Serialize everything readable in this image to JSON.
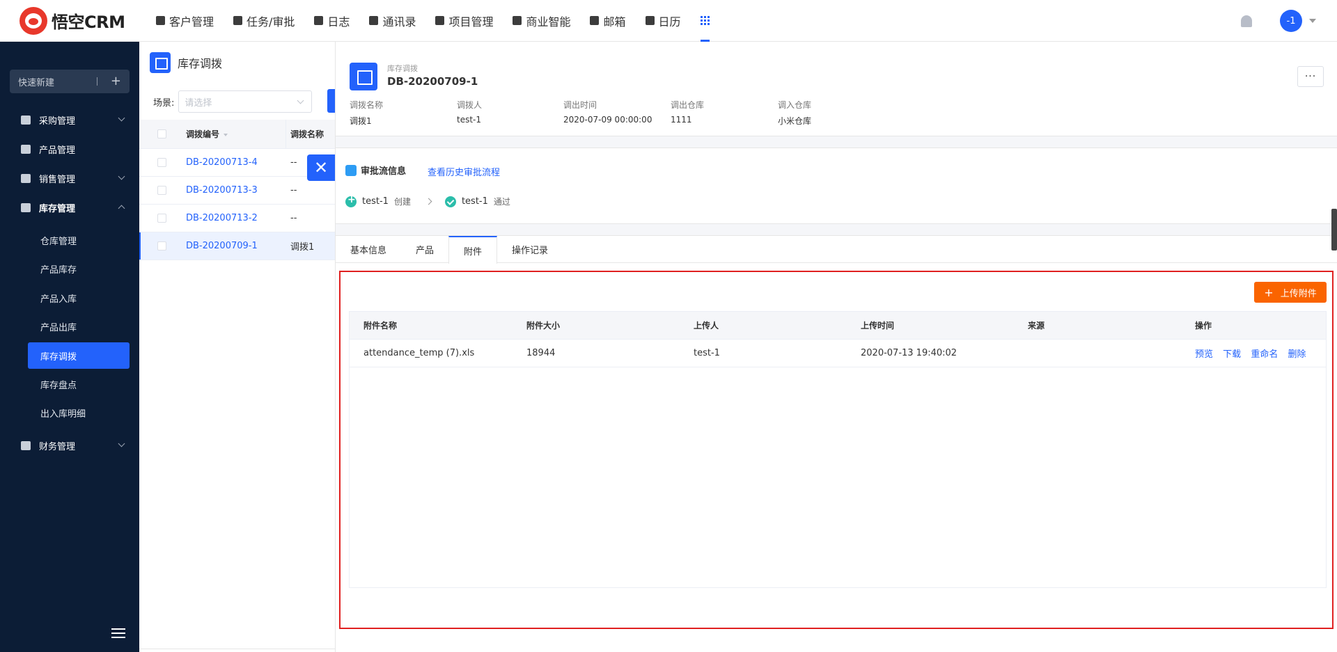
{
  "brand": {
    "name": "悟空CRM"
  },
  "nav": [
    {
      "label": "客户管理",
      "icon": "customer-icon"
    },
    {
      "label": "任务/审批",
      "icon": "task-icon"
    },
    {
      "label": "日志",
      "icon": "log-icon"
    },
    {
      "label": "通讯录",
      "icon": "contacts-icon"
    },
    {
      "label": "项目管理",
      "icon": "project-icon"
    },
    {
      "label": "商业智能",
      "icon": "bi-icon"
    },
    {
      "label": "邮箱",
      "icon": "mail-icon"
    },
    {
      "label": "日历",
      "icon": "calendar-icon"
    }
  ],
  "user": {
    "avatar_text": "-1"
  },
  "sidebar": {
    "quick_new": "快速新建",
    "menu": [
      {
        "label": "采购管理"
      },
      {
        "label": "产品管理"
      },
      {
        "label": "销售管理"
      },
      {
        "label": "库存管理"
      },
      {
        "label": "财务管理"
      }
    ],
    "sub": [
      "仓库管理",
      "产品库存",
      "产品入库",
      "产品出库",
      "库存调拨",
      "库存盘点",
      "出入库明细"
    ]
  },
  "list": {
    "title": "库存调拨",
    "scene_label": "场景:",
    "scene_placeholder": "请选择",
    "col_code": "调拨编号",
    "col_name": "调拨名称",
    "rows": [
      {
        "code": "DB-20200713-4",
        "name": "--"
      },
      {
        "code": "DB-20200713-3",
        "name": "--"
      },
      {
        "code": "DB-20200713-2",
        "name": "--"
      },
      {
        "code": "DB-20200709-1",
        "name": "调拨1"
      }
    ]
  },
  "detail": {
    "type": "库存调拨",
    "title": "DB-20200709-1",
    "more": "···",
    "fields": [
      {
        "label": "调拨名称",
        "value": "调拨1"
      },
      {
        "label": "调拨人",
        "value": "test-1"
      },
      {
        "label": "调出时间",
        "value": "2020-07-09 00:00:00"
      },
      {
        "label": "调出仓库",
        "value": "1111"
      },
      {
        "label": "调入仓库",
        "value": "小米仓库"
      }
    ],
    "approval": {
      "title": "审批流信息",
      "history_link": "查看历史审批流程",
      "steps": [
        {
          "who": "test-1",
          "action": "创建"
        },
        {
          "who": "test-1",
          "action": "通过"
        }
      ]
    },
    "tabs": [
      "基本信息",
      "产品",
      "附件",
      "操作记录"
    ],
    "upload_label": "上传附件",
    "attach_cols": [
      "附件名称",
      "附件大小",
      "上传人",
      "上传时间",
      "来源",
      "操作"
    ],
    "attachments": [
      {
        "name": "attendance_temp (7).xls",
        "size": "18944",
        "uploader": "test-1",
        "time": "2020-07-13 19:40:02",
        "source": ""
      }
    ],
    "ops": [
      "预览",
      "下载",
      "重命名",
      "删除"
    ]
  }
}
